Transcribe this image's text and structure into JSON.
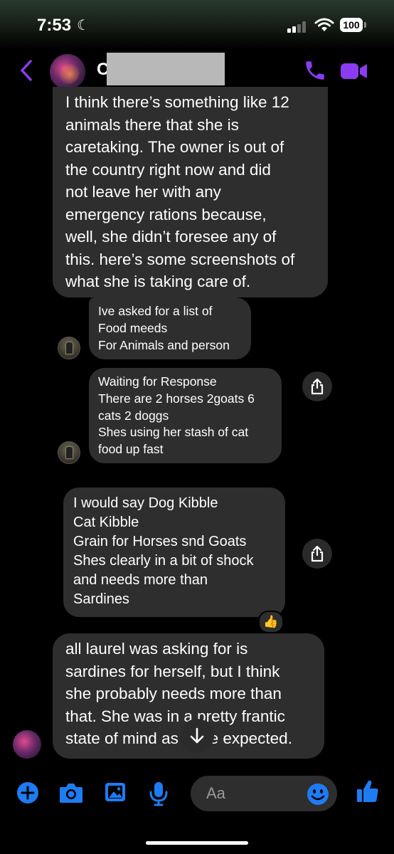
{
  "status_bar": {
    "time": "7:53",
    "battery": "100"
  },
  "header": {
    "contact_initial": "C"
  },
  "messages": [
    {
      "id": "m1",
      "lines": [
        "I think there’s something like 12",
        "animals there that she is",
        "caretaking. The owner is out of",
        "the country right now and did",
        "not leave her with any",
        "emergency rations because,",
        "well, she didn’t foresee any of",
        "this. here’s some screenshots of",
        "what she is taking care of."
      ]
    },
    {
      "id": "m2",
      "lines": [
        "Ive asked for a list of",
        "Food meeds",
        "For Animals and person"
      ]
    },
    {
      "id": "m3",
      "lines": [
        "Waiting for Response",
        "There are 2 horses 2goats 6",
        "cats 2 doggs",
        "Shes using her stash of cat",
        "food up fast"
      ]
    },
    {
      "id": "m4",
      "lines": [
        "I would say Dog Kibble",
        "Cat Kibble",
        "Grain for Horses  snd Goats",
        "Shes clearly in a bit of shock",
        "and needs more than",
        "Sardines"
      ],
      "reaction": "👍"
    },
    {
      "id": "m5",
      "lines": [
        "all laurel was asking for is",
        "sardines for herself, but I think",
        "she probably needs more than",
        "that. She was in a pretty frantic",
        "state of mind as to be expected."
      ]
    }
  ],
  "composer": {
    "placeholder": "Aa"
  },
  "colors": {
    "accent": "#8a3cf0",
    "blue": "#1e7cf2",
    "bubble": "#2e2e2e",
    "background": "#000000"
  },
  "icons": [
    "back-chevron-icon",
    "phone-icon",
    "video-camera-icon",
    "share-icon",
    "scroll-down-arrow-icon",
    "plus-icon",
    "camera-icon",
    "gallery-icon",
    "microphone-icon",
    "emoji-icon",
    "thumbs-up-icon"
  ]
}
